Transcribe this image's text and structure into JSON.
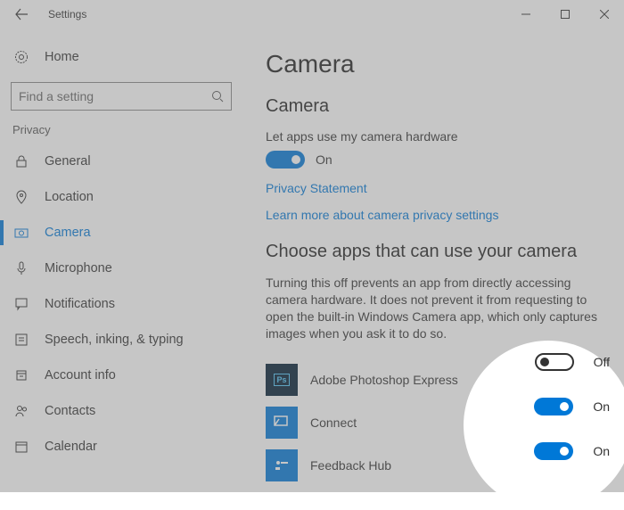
{
  "titlebar": {
    "title": "Settings"
  },
  "sidebar": {
    "home_label": "Home",
    "search_placeholder": "Find a setting",
    "group_label": "Privacy",
    "items": [
      {
        "label": "General"
      },
      {
        "label": "Location"
      },
      {
        "label": "Camera"
      },
      {
        "label": "Microphone"
      },
      {
        "label": "Notifications"
      },
      {
        "label": "Speech, inking, & typing"
      },
      {
        "label": "Account info"
      },
      {
        "label": "Contacts"
      },
      {
        "label": "Calendar"
      }
    ]
  },
  "main": {
    "page_title": "Camera",
    "section1_title": "Camera",
    "let_apps_label": "Let apps use my camera hardware",
    "master_toggle": {
      "state": "on",
      "text": "On"
    },
    "link1": "Privacy Statement",
    "link2": "Learn more about camera privacy settings",
    "section2_title": "Choose apps that can use your camera",
    "section2_desc": "Turning this off prevents an app from directly accessing camera hardware. It does not prevent it from requesting to open the built-in Windows Camera app, which only captures images when you ask it to do so.",
    "apps": [
      {
        "name": "Adobe Photoshop Express",
        "toggle_state": "off",
        "toggle_text": "Off"
      },
      {
        "name": "Connect",
        "toggle_state": "on",
        "toggle_text": "On"
      },
      {
        "name": "Feedback Hub",
        "toggle_state": "on",
        "toggle_text": "On"
      }
    ]
  }
}
